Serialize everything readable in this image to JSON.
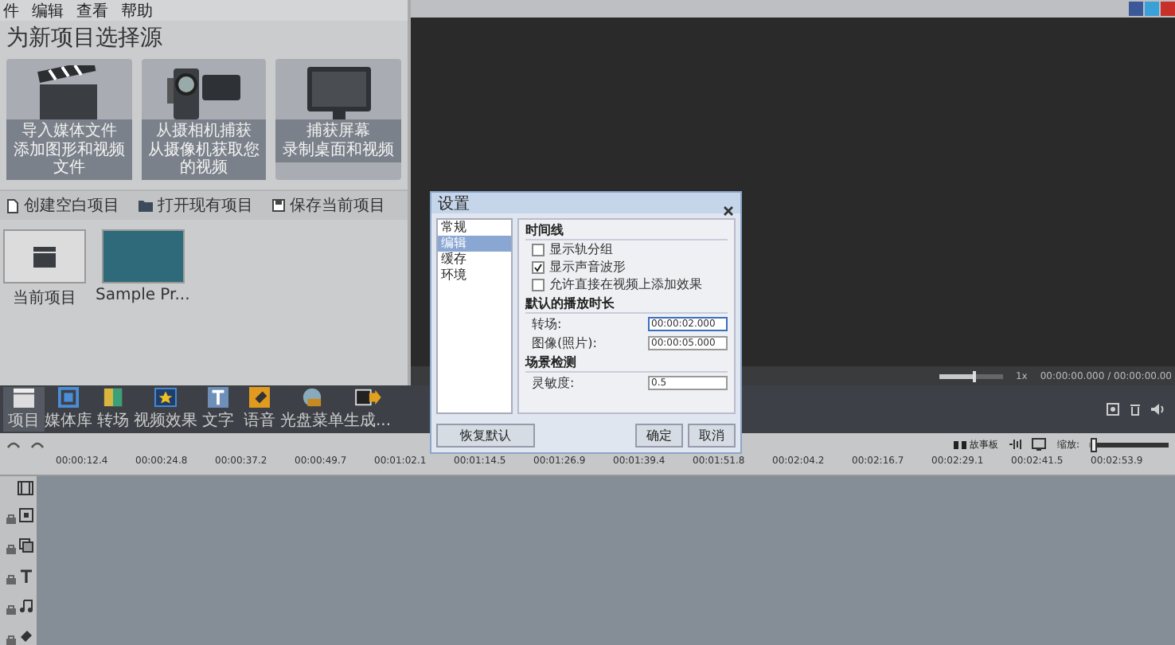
{
  "menu": [
    "件",
    "编辑",
    "查看",
    "帮助"
  ],
  "heading": "为新项目选择源",
  "source_cards": [
    {
      "kind": "clapper",
      "title": "导入媒体文件",
      "subtitle": "添加图形和视频文件"
    },
    {
      "kind": "camera",
      "title": "从摄相机捕获",
      "subtitle": "从摄像机获取您的视频"
    },
    {
      "kind": "monitor",
      "title": "捕获屏幕",
      "subtitle": "录制桌面和视频"
    }
  ],
  "project_actions": [
    {
      "kind": "new",
      "label": "创建空白项目"
    },
    {
      "kind": "open",
      "label": "打开现有项目"
    },
    {
      "kind": "save",
      "label": "保存当前项目"
    }
  ],
  "projects": [
    {
      "kind": "current",
      "label": "当前项目"
    },
    {
      "kind": "sample",
      "label": "Sample Pr..."
    }
  ],
  "player": {
    "volume": {
      "level": 0.55
    },
    "speed": "1x",
    "time": "00:00:00.000 / 00:00:00.00"
  },
  "main_toolbar": [
    {
      "kind": "project",
      "label": "项目",
      "selected": true
    },
    {
      "kind": "library",
      "label": "媒体库",
      "selected": false
    },
    {
      "kind": "transition",
      "label": "转场",
      "selected": false
    },
    {
      "kind": "effect",
      "label": "视频效果",
      "selected": false
    },
    {
      "kind": "text",
      "label": "文字",
      "selected": false
    },
    {
      "kind": "voice",
      "label": "语音",
      "selected": false
    },
    {
      "kind": "disc",
      "label": "光盘菜单",
      "selected": false
    },
    {
      "kind": "produce",
      "label": "生成...",
      "selected": false
    }
  ],
  "timeline": {
    "storyboard": "故事板",
    "zoom_label": "缩放:",
    "zoom": {
      "level": 0.05
    },
    "ticks": [
      "00:00:12.4",
      "00:00:24.8",
      "00:00:37.2",
      "00:00:49.7",
      "00:01:02.1",
      "00:01:14.5",
      "00:01:26.9",
      "00:01:39.4",
      "00:01:51.8",
      "00:02:04.2",
      "00:02:16.7",
      "00:02:29.1",
      "00:02:41.5",
      "00:02:53.9"
    ],
    "tracks": [
      {
        "kind": "video",
        "locked": false
      },
      {
        "kind": "effect",
        "locked": true
      },
      {
        "kind": "overlay",
        "locked": true
      },
      {
        "kind": "text",
        "locked": true
      },
      {
        "kind": "music",
        "locked": true
      },
      {
        "kind": "voice",
        "locked": true
      }
    ]
  },
  "dialog": {
    "title": "设置",
    "nav": [
      {
        "label": "常规",
        "selected": false
      },
      {
        "label": "编辑",
        "selected": true
      },
      {
        "label": "缓存",
        "selected": false
      },
      {
        "label": "环境",
        "selected": false
      }
    ],
    "timeline_section": "时间线",
    "options": [
      {
        "label": "显示轨分组",
        "checked": false
      },
      {
        "label": "显示声音波形",
        "checked": true
      },
      {
        "label": "允许直接在视频上添加效果",
        "checked": false
      }
    ],
    "duration_section": "默认的播放时长",
    "fields": [
      {
        "label": "转场:",
        "value": "00:00:02.000",
        "focused": true
      },
      {
        "label": "图像(照片):",
        "value": "00:00:05.000",
        "focused": false
      }
    ],
    "scene_section": "场景检测",
    "sensitivity": {
      "label": "灵敏度:",
      "value": "0.5"
    },
    "buttons": [
      {
        "kind": "reset",
        "label": "恢复默认"
      },
      {
        "kind": "ok",
        "label": "确定"
      },
      {
        "kind": "cancel",
        "label": "取消"
      }
    ]
  }
}
